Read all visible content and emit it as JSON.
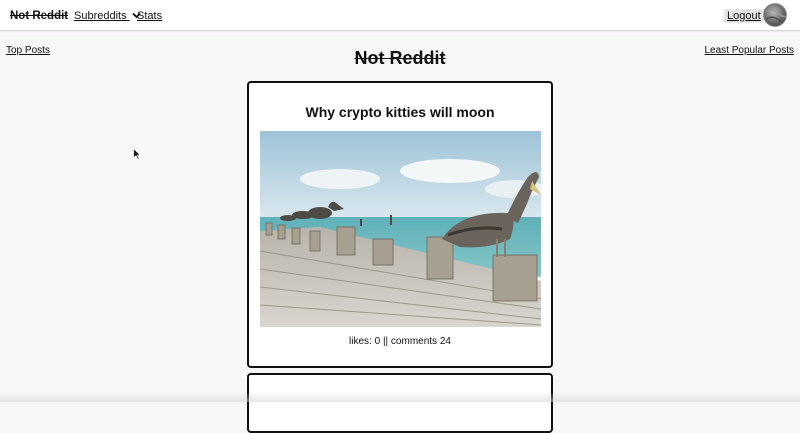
{
  "navbar": {
    "brand": "Not Reddit",
    "subreddits_label": "Subreddits",
    "stats_label": "Stats",
    "logout_label": "Logout"
  },
  "side_links": {
    "top_posts": "Top Posts",
    "least_popular": "Least Popular Posts"
  },
  "page_title": "Not Reddit",
  "posts": [
    {
      "title": "Why crypto kitties will moon",
      "likes": "likes: 0",
      "separator": "||",
      "comments": "comments 24",
      "image_subject": "pelicans-on-pier-photo"
    },
    {
      "title": ""
    }
  ]
}
